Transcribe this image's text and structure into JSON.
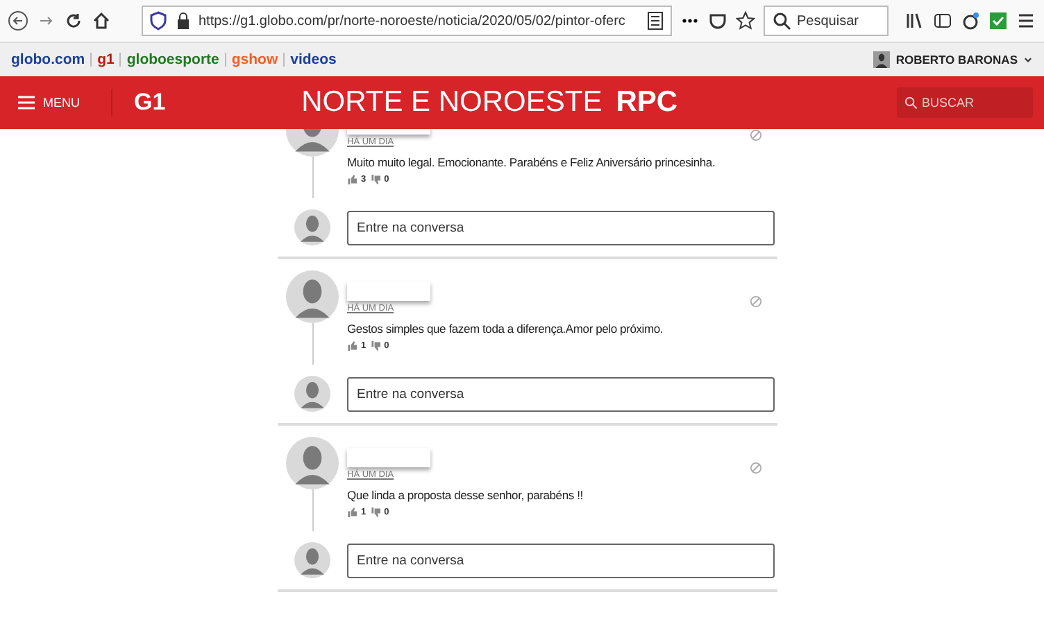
{
  "browser": {
    "url": "https://g1.globo.com/pr/norte-noroeste/noticia/2020/05/02/pintor-oferc",
    "search": {
      "placeholder": "Pesquisar"
    }
  },
  "bookmarks": [
    {
      "label": "globo.com",
      "color": "#1a3f9a"
    },
    {
      "label": "g1",
      "color": "#c4170c"
    },
    {
      "label": "globoesporte",
      "color": "#1f7a1f"
    },
    {
      "label": "gshow",
      "color": "#ff5a1f"
    },
    {
      "label": "videos",
      "color": "#1a3f9a"
    }
  ],
  "user": {
    "name": "ROBERTO BARONAS"
  },
  "header": {
    "menu": "MENU",
    "logo": "G1",
    "title": "NORTE E NOROESTE",
    "brand": "RPC",
    "search": {
      "placeholder": "BUSCAR"
    }
  },
  "comments": [
    {
      "time": "HÁ UM DIA",
      "text": "Muito muito legal. Emocionante. Parabéns e Feliz Aniversário princesinha.",
      "likes": "3",
      "dislikes": "0",
      "reply": {
        "placeholder": "Entre na conversa"
      }
    },
    {
      "time": "HÁ UM DIA",
      "text": "Gestos simples que fazem toda a diferença.Amor pelo próximo.",
      "likes": "1",
      "dislikes": "0",
      "reply": {
        "placeholder": "Entre na conversa"
      }
    },
    {
      "time": "HÁ UM DIA",
      "text": "Que linda a proposta desse senhor, parabéns !!",
      "likes": "1",
      "dislikes": "0",
      "reply": {
        "placeholder": "Entre na conversa"
      }
    }
  ]
}
